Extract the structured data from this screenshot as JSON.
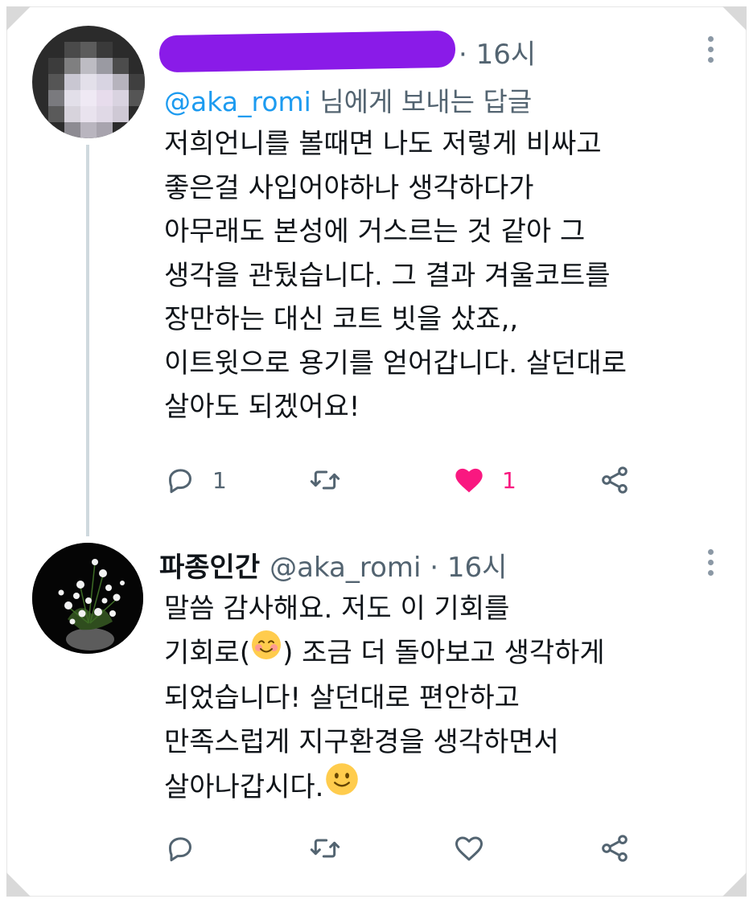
{
  "tweets": [
    {
      "author_name": "",
      "time": "· 16시",
      "replying_to": {
        "handle": "@aka_romi",
        "suffix": " 님에게 보내는 답글"
      },
      "lines": [
        "저희언니를 볼때면 나도 저렇게 비싸고",
        "좋은걸 사입어야하나 생각하다가",
        "아무래도 본성에 거스르는 것 같아 그",
        "생각을 관뒀습니다. 그 결과 겨울코트를",
        "장만하는 대신 코트 빗을 샀죠,,",
        "이트윗으로 용기를 얻어갑니다. 살던대로",
        "살아도 되겠어요!"
      ],
      "actions": {
        "reply_count": "1",
        "retweet_count": "",
        "like_count": "1",
        "liked": true
      }
    },
    {
      "author_name": "파종인간",
      "meta": "@aka_romi · 16시",
      "lines": [
        "말씀 감사해요. 저도 이 기회를",
        "기회로(",
        ") 조금 더 돌아보고 생각하게",
        "되었습니다! 살던대로 편안하고",
        "만족스럽게 지구환경을 생각하면서",
        "살아나갑시다."
      ],
      "emojis": [
        "smiling-face-with-blush-emoji",
        "slightly-smiling-face-emoji"
      ],
      "actions": {
        "reply_count": "",
        "retweet_count": "",
        "like_count": "",
        "liked": false
      }
    }
  ],
  "colors": {
    "redaction": "#8a1be8",
    "link": "#1d9bf0",
    "like": "#f91880",
    "muted": "#536471"
  }
}
